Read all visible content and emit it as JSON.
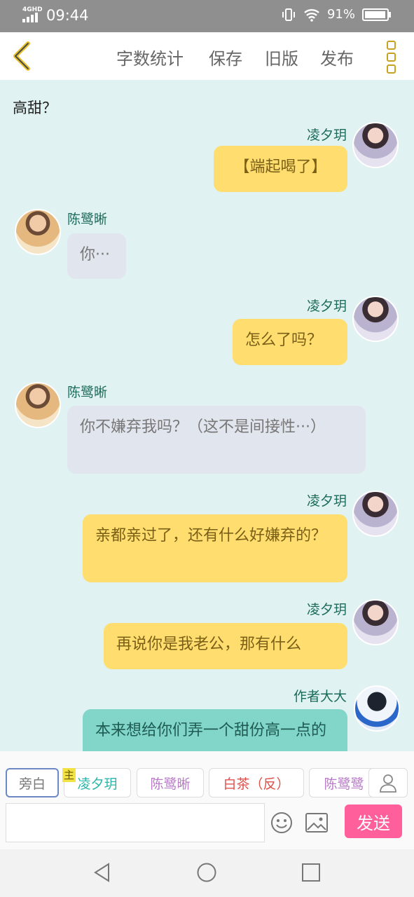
{
  "status": {
    "network": "4GHD",
    "time": "09:44",
    "battery": "91%"
  },
  "toolbar": {
    "word_count": "字数统计",
    "save": "保存",
    "old_version": "旧版",
    "publish": "发布"
  },
  "chat": {
    "narration": "高甜？",
    "messages": [
      {
        "speaker": "凌夕玥",
        "text": "【端起喝了】"
      },
      {
        "speaker": "陈鹭晰",
        "text": "你···"
      },
      {
        "speaker": "凌夕玥",
        "text": "怎么了吗？"
      },
      {
        "speaker": "陈鹭晰",
        "text": "你不嫌弃我吗？（这不是间接性···）"
      },
      {
        "speaker": "凌夕玥",
        "text": "亲都亲过了，还有什么好嫌弃的？"
      },
      {
        "speaker": "凌夕玥",
        "text": "再说你是我老公，那有什么"
      },
      {
        "speaker": "作者大大",
        "text": "本来想给你们弄一个甜份高一点的"
      }
    ]
  },
  "characters": {
    "main_tag": "主",
    "chips": [
      {
        "label": "旁白",
        "color": "#777777"
      },
      {
        "label": "凌夕玥",
        "color": "#2bb5a8"
      },
      {
        "label": "陈鹭晰",
        "color": "#b77ac6"
      },
      {
        "label": "白茶（反）",
        "color": "#e0504a"
      },
      {
        "label": "陈鹭鹭",
        "color": "#b77ac6"
      }
    ]
  },
  "input": {
    "placeholder": "",
    "send": "发送"
  }
}
